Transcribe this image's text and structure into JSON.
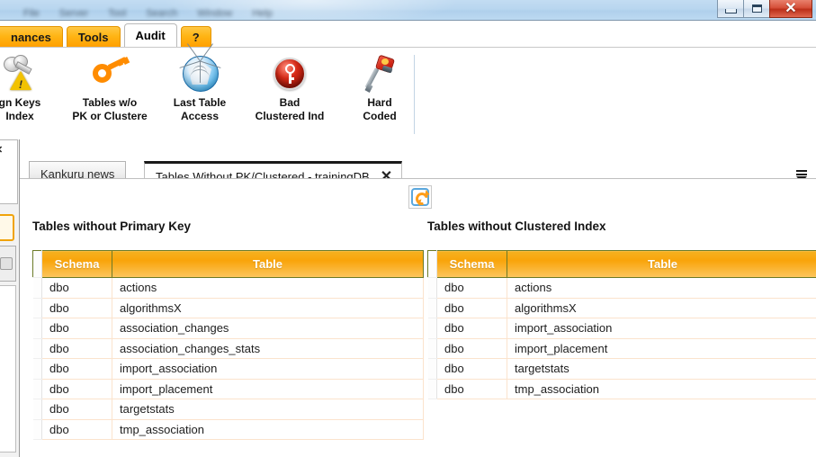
{
  "window": {
    "menu_blurred": [
      "File",
      "Server",
      "Tool",
      "Search",
      "Window",
      "Help"
    ],
    "controls": {
      "minimize": "minimize-button",
      "maximize": "maximize-button",
      "close": "✕"
    }
  },
  "ribbon": {
    "tabs": [
      {
        "label": "nances",
        "active": false
      },
      {
        "label": "Tools",
        "active": false
      },
      {
        "label": "Audit",
        "active": true
      },
      {
        "label": "?",
        "active": false
      }
    ],
    "items": [
      {
        "icon": "keys-warning-icon",
        "line1": "gn Keys",
        "line2": "Index"
      },
      {
        "icon": "orange-key-icon",
        "line1": "Tables w/o",
        "line2": "PK or Clustere"
      },
      {
        "icon": "spider-web-orb-icon",
        "line1": "Last Table",
        "line2": "Access"
      },
      {
        "icon": "red-key-orb-icon",
        "line1": "Bad",
        "line2": "Clustered Ind"
      },
      {
        "icon": "jackhammer-icon",
        "line1": "Hard",
        "line2": "Coded"
      }
    ]
  },
  "doc_tabs": {
    "inactive": {
      "label": "Kankuru news"
    },
    "active": {
      "label": "Tables Without PK/Clustered - trainingDB",
      "close": "✕"
    },
    "overflow_icon": "tab-overflow-icon"
  },
  "toolbar": {
    "refresh_icon": "refresh-icon"
  },
  "colors": {
    "header_orange": "#f9a40a",
    "tab_orange": "#ffb414",
    "header_border": "#6b7a27",
    "row_separator": "#fbe3cd",
    "titlebar_blue": "#b9d6ef",
    "close_red": "#d6503a"
  },
  "panels": [
    {
      "title": "Tables without Primary Key",
      "columns": [
        "Schema",
        "Table"
      ],
      "rows": [
        {
          "schema": "dbo",
          "table": "actions"
        },
        {
          "schema": "dbo",
          "table": "algorithmsX"
        },
        {
          "schema": "dbo",
          "table": "association_changes"
        },
        {
          "schema": "dbo",
          "table": "association_changes_stats"
        },
        {
          "schema": "dbo",
          "table": "import_association"
        },
        {
          "schema": "dbo",
          "table": "import_placement"
        },
        {
          "schema": "dbo",
          "table": "targetstats"
        },
        {
          "schema": "dbo",
          "table": "tmp_association"
        }
      ]
    },
    {
      "title": "Tables without Clustered Index",
      "columns": [
        "Schema",
        "Table"
      ],
      "rows": [
        {
          "schema": "dbo",
          "table": "actions"
        },
        {
          "schema": "dbo",
          "table": "algorithmsX"
        },
        {
          "schema": "dbo",
          "table": "import_association"
        },
        {
          "schema": "dbo",
          "table": "import_placement"
        },
        {
          "schema": "dbo",
          "table": "targetstats"
        },
        {
          "schema": "dbo",
          "table": "tmp_association"
        }
      ]
    }
  ]
}
